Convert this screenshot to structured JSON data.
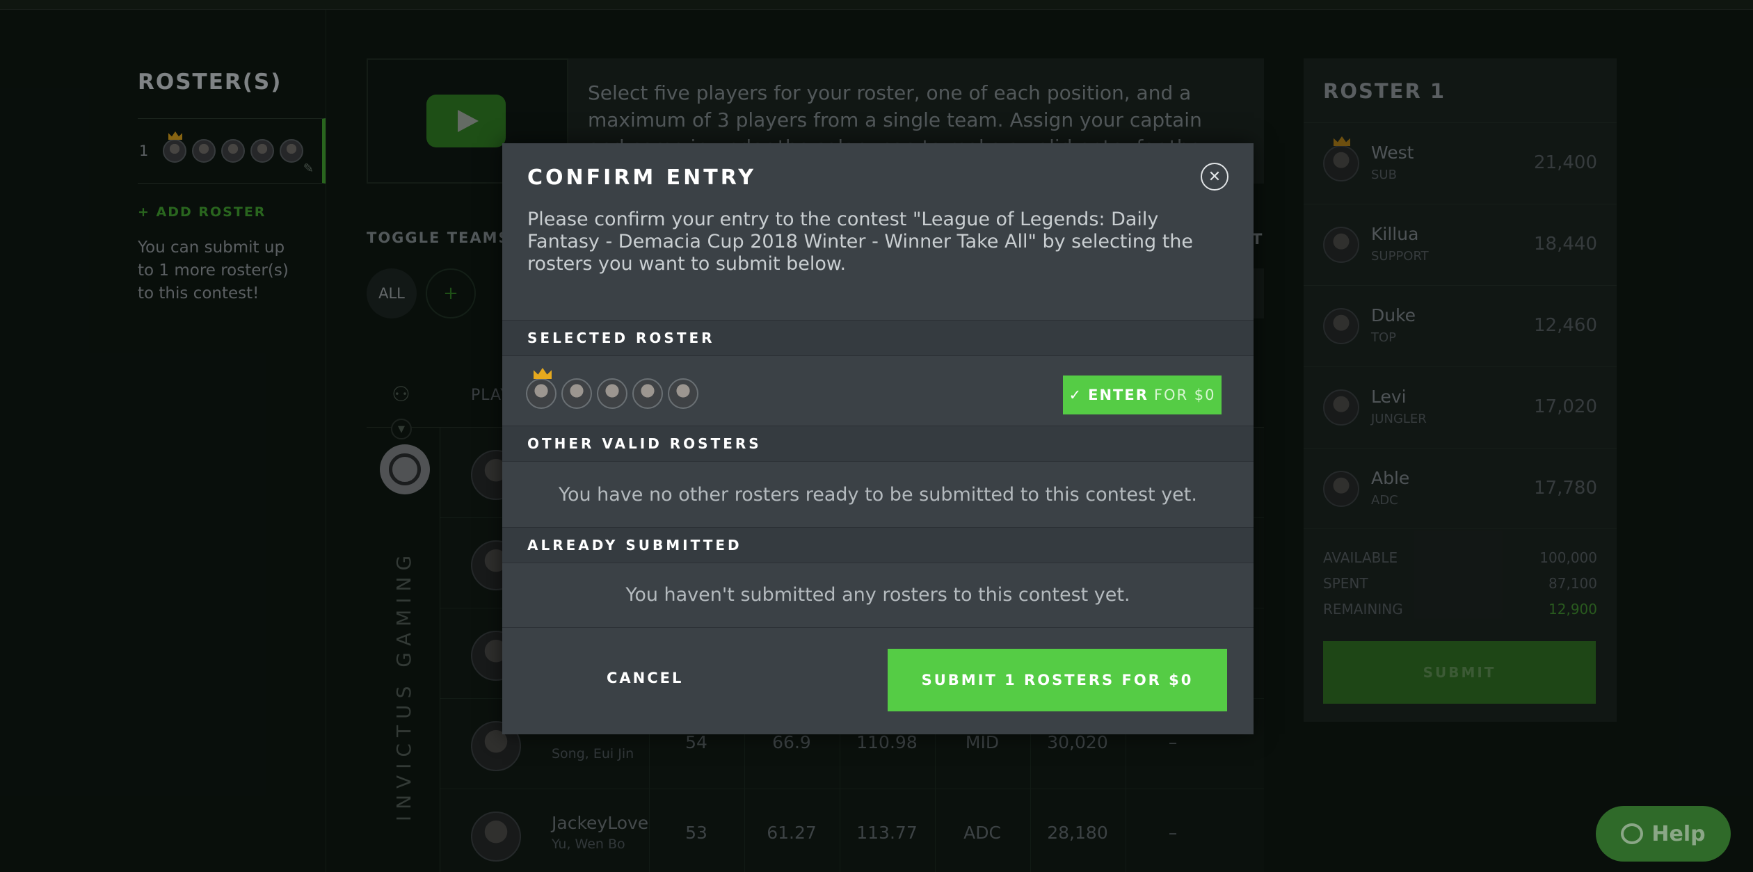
{
  "rosters": {
    "title": "ROSTER(S)",
    "row_number": "1",
    "add_label": "+ ADD ROSTER",
    "note": "You can submit up to 1 more roster(s) to this contest!"
  },
  "instructions": "Select five players for your roster, one of each position, and a maximum of 3 players from a single team. Assign your captain and come in under the salary cap to make a valid entry for the lineup!",
  "toggle": {
    "title": "TOGGLE TEAMS",
    "all_label": "ALL",
    "plus_label": "+",
    "sort_partial": "T"
  },
  "table": {
    "player_header": "PLAY",
    "team_name": "INVICTUS GAMING",
    "rows": [
      {
        "name": "",
        "real": "",
        "c1": "",
        "c2": "",
        "c3": "",
        "pos": "",
        "sal": "",
        "dash": ""
      },
      {
        "name": "",
        "real": "",
        "c1": "",
        "c2": "",
        "c3": "",
        "pos": "",
        "sal": "",
        "dash": ""
      },
      {
        "name": "",
        "real": "",
        "c1": "",
        "c2": "",
        "c3": "",
        "pos": "",
        "sal": "",
        "dash": ""
      },
      {
        "name": "",
        "real": "Song, Eui Jin",
        "c1": "54",
        "c2": "66.9",
        "c3": "110.98",
        "pos": "MID",
        "sal": "30,020",
        "dash": "–"
      },
      {
        "name": "JackeyLove",
        "real": "Yu, Wen Bo",
        "c1": "53",
        "c2": "61.27",
        "c3": "113.77",
        "pos": "ADC",
        "sal": "28,180",
        "dash": "–"
      }
    ]
  },
  "roster_panel": {
    "title": "ROSTER 1",
    "players": [
      {
        "name": "West",
        "pos": "SUB",
        "salary": "21,400"
      },
      {
        "name": "Killua",
        "pos": "SUPPORT",
        "salary": "18,440"
      },
      {
        "name": "Duke",
        "pos": "TOP",
        "salary": "12,460"
      },
      {
        "name": "Levi",
        "pos": "JUNGLER",
        "salary": "17,020"
      },
      {
        "name": "Able",
        "pos": "ADC",
        "salary": "17,780"
      }
    ],
    "available_label": "AVAILABLE",
    "available": "100,000",
    "spent_label": "SPENT",
    "spent": "87,100",
    "remaining_label": "REMAINING",
    "remaining": "12,900",
    "submit_label": "SUBMIT"
  },
  "help_label": "Help",
  "modal": {
    "title": "CONFIRM ENTRY",
    "close_glyph": "✕",
    "description": "Please confirm your entry to the contest \"League of Legends: Daily Fantasy - Demacia Cup 2018 Winter - Winner Take All\" by selecting the rosters you want to submit below.",
    "selected_heading": "SELECTED ROSTER",
    "enter_check": "✓",
    "enter_label": "ENTER",
    "enter_price": "FOR $0",
    "other_heading": "OTHER VALID ROSTERS",
    "other_message": "You have no other rosters ready to be submitted to this contest yet.",
    "submitted_heading": "ALREADY SUBMITTED",
    "submitted_message": "You haven't submitted any rosters to this contest yet.",
    "cancel_label": "CANCEL",
    "submit_label": "SUBMIT 1 ROSTERS FOR $0"
  },
  "colors": {
    "accent_green": "#55cc45",
    "dark_green": "#2e6c22",
    "modal_bg": "#3b4146",
    "page_bg": "#0e1712",
    "crown_gold": "#e6a91e"
  }
}
